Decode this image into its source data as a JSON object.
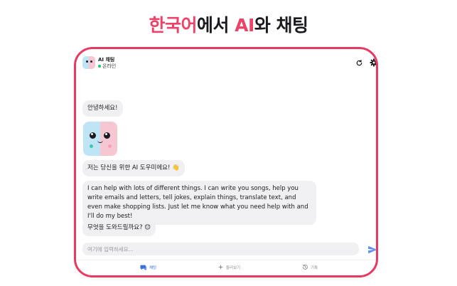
{
  "headline": {
    "part1": "한국어",
    "part2": "에서 ",
    "part3": "AI",
    "part4": "와 채팅"
  },
  "header": {
    "bot_name": "AI 채팅",
    "status": "온라인"
  },
  "messages": {
    "greeting": "안녕하세요!",
    "intro": "저는 당신을 위한 AI 도우미에요! 👋",
    "capabilities": "I can help with lots of different things. I can write you songs, help you write emails and letters, tell jokes, explain things, translate text, and even make shopping lists. Just let me know what you need help with and I'll do my best!",
    "question": "무엇을 도와드릴까요? 😊"
  },
  "composer": {
    "placeholder": "여기에 입력하세요..."
  },
  "tabs": {
    "chat": "채팅",
    "explore": "둘러보기",
    "history": "기록"
  },
  "colors": {
    "accent": "#e73a62",
    "tab_active": "#3b6fd8",
    "send": "#5b8fe8",
    "online": "#28c26b"
  },
  "icons": {
    "refresh": "refresh-icon",
    "settings": "gear-icon",
    "send": "send-icon",
    "chat_tab": "chat-bubble-icon",
    "explore_tab": "sparkle-icon",
    "history_tab": "history-icon"
  }
}
